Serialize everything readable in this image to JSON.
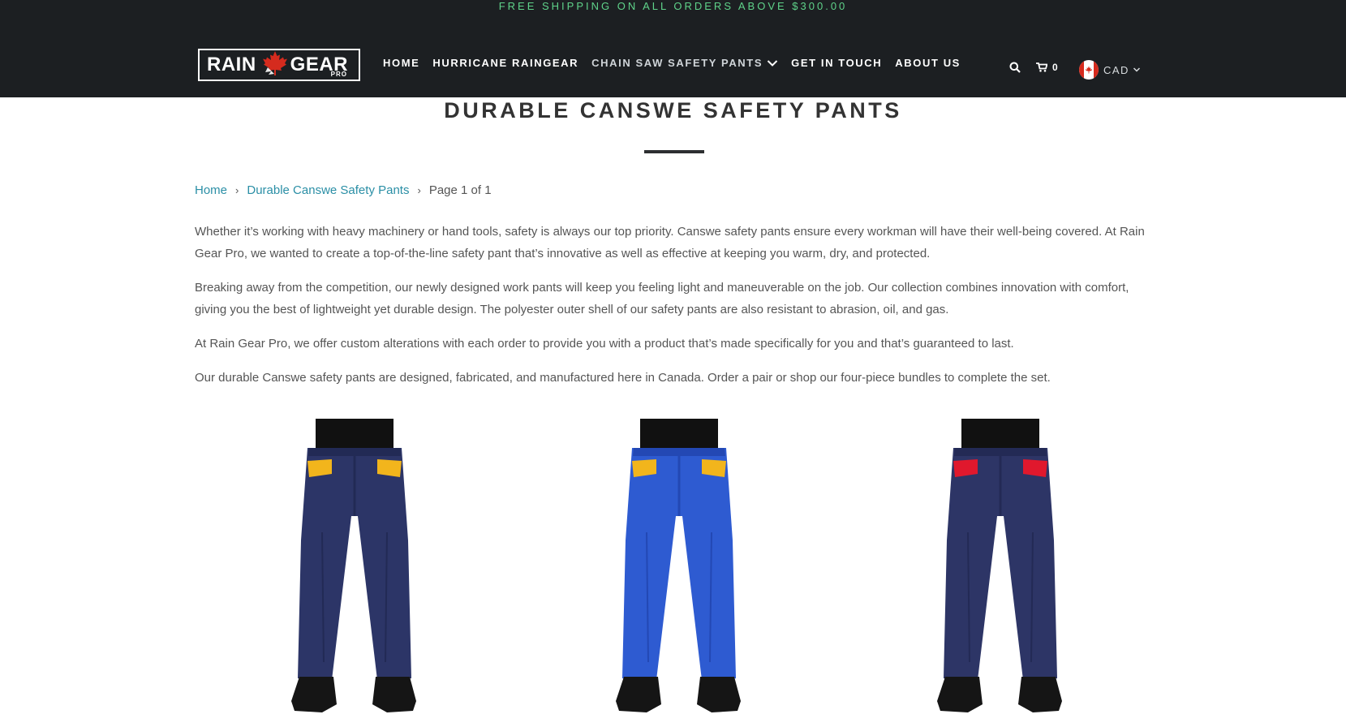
{
  "promo": {
    "text": "FREE SHIPPING ON ALL ORDERS ABOVE $300.00"
  },
  "logo": {
    "rain": "RAIN",
    "gear": "GEAR",
    "pro": "PRO"
  },
  "nav": {
    "items": [
      {
        "label": "HOME"
      },
      {
        "label": "HURRICANE RAINGEAR"
      },
      {
        "label": "CHAIN SAW SAFETY PANTS"
      },
      {
        "label": "GET IN TOUCH"
      },
      {
        "label": "ABOUT US"
      }
    ]
  },
  "cart": {
    "count": "0"
  },
  "currency": {
    "code": "CAD"
  },
  "page": {
    "title": "DURABLE CANSWE SAFETY PANTS"
  },
  "breadcrumb": {
    "home": "Home",
    "collection": "Durable Canswe Safety Pants",
    "current": "Page 1 of 1"
  },
  "description": {
    "paragraphs": [
      "Whether it’s working with heavy machinery or hand tools, safety is always our top priority. Canswe safety pants ensure every workman will have their well-being covered. At Rain Gear Pro, we wanted to create a top-of-the-line safety pant that’s innovative as well as effective at keeping you warm, dry, and protected.",
      "Breaking away from the competition, our newly designed work pants will keep you feeling light and maneuverable on the job. Our collection combines innovation with comfort, giving you the best of lightweight yet durable design. The polyester outer shell of our safety pants are also resistant to abrasion, oil, and gas.",
      "At Rain Gear Pro, we offer custom alterations with each order to provide you with a product that’s made specifically for you and that’s guaranteed to last.",
      "Our durable Canswe safety pants are designed, fabricated, and manufactured here in Canada. Order a pair or shop our four-piece bundles to complete the set."
    ]
  },
  "products": [
    {
      "pant_color": "#2c3567",
      "pant_shade": "#222a55",
      "pocket_color": "#f2b51c"
    },
    {
      "pant_color": "#2e5bd1",
      "pant_shade": "#2348b4",
      "pocket_color": "#f2b51c"
    },
    {
      "pant_color": "#2d3566",
      "pant_shade": "#232a55",
      "pocket_color": "#e0182d"
    }
  ],
  "colors": {
    "header_bg": "#1c1f22",
    "promo_text": "#5fd38a",
    "link": "#2b8fa6",
    "logo_leaf": "#d52b1e"
  }
}
